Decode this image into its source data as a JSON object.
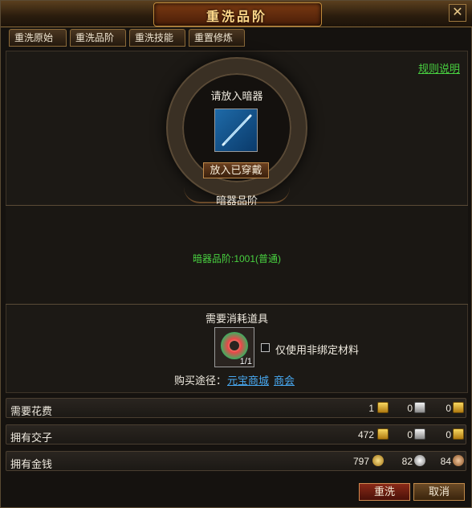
{
  "window": {
    "title": "重洗品阶",
    "close_symbol": "✕"
  },
  "tabs": [
    "重洗原始",
    "重洗品阶",
    "重洗技能",
    "重置修炼"
  ],
  "rules_link": "规则说明",
  "slot": {
    "prompt": "请放入暗器",
    "equip_button": "放入已穿戴",
    "item_icon": "needle-weapon-icon"
  },
  "quality": {
    "header": "暗器品阶",
    "text": "暗器品阶:1001(普通)"
  },
  "consume": {
    "label": "需要消耗道具",
    "count": "1/1",
    "material_icon": "jade-ring-icon",
    "checkbox_label": "仅使用非绑定材料"
  },
  "buy": {
    "label": "购买途径：",
    "link1": "元宝商城",
    "link2": "商会"
  },
  "rows": {
    "cost": {
      "label": "需要花费",
      "v1": "1",
      "v2": "0",
      "v3": "0"
    },
    "notes": {
      "label": "拥有交子",
      "v1": "472",
      "v2": "0",
      "v3": "0"
    },
    "money": {
      "label": "拥有金钱",
      "v1": "797",
      "v2": "82",
      "v3": "84"
    }
  },
  "buttons": {
    "wash": "重洗",
    "cancel": "取消"
  }
}
